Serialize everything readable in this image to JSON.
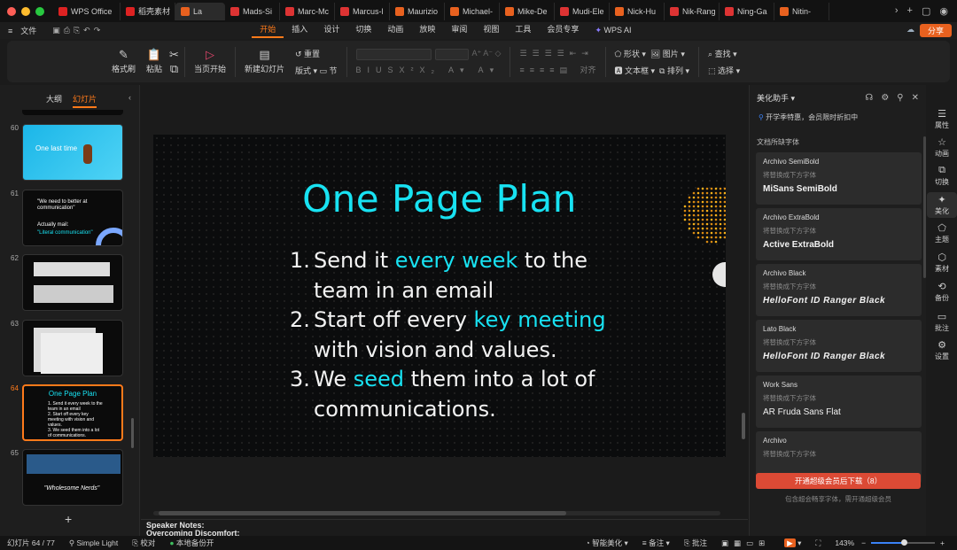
{
  "tabs": [
    {
      "label": "WPS Office",
      "color": "#d22"
    },
    {
      "label": "稻壳素材",
      "color": "#d22"
    },
    {
      "label": "La",
      "color": "#e8611f",
      "active": true
    },
    {
      "label": "Mads-Si",
      "color": "#d33"
    },
    {
      "label": "Marc-Mc",
      "color": "#d33"
    },
    {
      "label": "Marcus-l",
      "color": "#d33"
    },
    {
      "label": "Maurizio",
      "color": "#e8611f"
    },
    {
      "label": "Michael-",
      "color": "#e8611f"
    },
    {
      "label": "Mike-De",
      "color": "#e8611f"
    },
    {
      "label": "Mudi-Ele",
      "color": "#d33"
    },
    {
      "label": "Nick-Hu",
      "color": "#e8611f"
    },
    {
      "label": "Nik-Rang",
      "color": "#d33"
    },
    {
      "label": "Ning-Ga",
      "color": "#d33"
    },
    {
      "label": "Nitin-",
      "color": "#e8611f"
    }
  ],
  "menu": {
    "file": "文件",
    "items": [
      "开始",
      "插入",
      "设计",
      "切换",
      "动画",
      "放映",
      "审阅",
      "视图",
      "工具",
      "会员专享"
    ],
    "wps_ai": "WPS AI",
    "share": "分享"
  },
  "ribbon": {
    "format_painter": "格式刷",
    "paste": "粘贴",
    "from_start": "当页开始",
    "new_slide": "新建幻灯片",
    "layout": "版式",
    "reset": "重置",
    "section": "节",
    "shape": "形状",
    "picture": "图片",
    "find": "查找",
    "textbox": "文本框",
    "arrange": "排列",
    "select": "选择",
    "align": "对齐"
  },
  "left_panel": {
    "outline_tab": "大纲",
    "slides_tab": "幻灯片",
    "slides": [
      {
        "num": "60",
        "title": "One last time"
      },
      {
        "num": "61",
        "line1": "\"We need to better at communication\"",
        "line2": "Actually mail:",
        "line3": "\"Literal communication\""
      },
      {
        "num": "62"
      },
      {
        "num": "63"
      },
      {
        "num": "64",
        "title": "One Page Plan",
        "lines": [
          "1. Send it every week to the",
          "team in an email",
          "2. Start off every key",
          "meeting with vision and",
          "values.",
          "3. We seed them into a lot",
          "of communications."
        ]
      },
      {
        "num": "65",
        "caption": "\"Wholesome Nerds\""
      }
    ],
    "add": "+"
  },
  "slide": {
    "title": "One Page Plan",
    "items": [
      {
        "num": "1.",
        "parts": [
          [
            "Send it ",
            false
          ],
          [
            "every week",
            true
          ],
          [
            " to the team in an email",
            false
          ]
        ]
      },
      {
        "num": "2.",
        "parts": [
          [
            "Start off every ",
            false
          ],
          [
            "key meeting",
            true
          ],
          [
            " with vision and values.",
            false
          ]
        ]
      },
      {
        "num": "3.",
        "parts": [
          [
            "We ",
            false
          ],
          [
            "seed",
            true
          ],
          [
            " them into a lot of communications.",
            false
          ]
        ]
      }
    ]
  },
  "notes": {
    "label": "Speaker Notes:",
    "text": "Overcoming Discomfort:"
  },
  "right_panel": {
    "title": "美化助手",
    "promo": "开学季特惠，会员限时折扣中",
    "section": "文档所缺字体",
    "fonts": [
      {
        "src": "Archivo SemiBold",
        "hint": "将替换成下方字体",
        "tgt": "MiSans SemiBold",
        "style": "bold"
      },
      {
        "src": "Archivo ExtraBold",
        "hint": "将替换成下方字体",
        "tgt": "Active ExtraBold",
        "style": "bold"
      },
      {
        "src": "Archivo Black",
        "hint": "将替换成下方字体",
        "tgt": "HelloFont ID Ranger Black",
        "style": "it"
      },
      {
        "src": "Lato Black",
        "hint": "将替换成下方字体",
        "tgt": "HelloFont ID Ranger Black",
        "style": "it"
      },
      {
        "src": "Work Sans",
        "hint": "将替换成下方字体",
        "tgt": "AR Fruda Sans Flat",
        "style": "plain"
      },
      {
        "src": "Archivo",
        "hint": "将替换成下方字体",
        "tgt": "",
        "style": "plain"
      }
    ],
    "download": "开通超级会员后下载（8）",
    "note": "包含超会畅享字体，需开通超级会员"
  },
  "sidebar": [
    "属性",
    "动画",
    "切换",
    "美化",
    "主题",
    "素材",
    "备份",
    "批注",
    "设置"
  ],
  "status": {
    "slide_count": "幻灯片 64 / 77",
    "theme": "Simple Light",
    "proof": "校对",
    "backup": "本地备份开",
    "smart": "智能美化",
    "notes": "备注",
    "comments": "批注",
    "zoom": "143%"
  }
}
